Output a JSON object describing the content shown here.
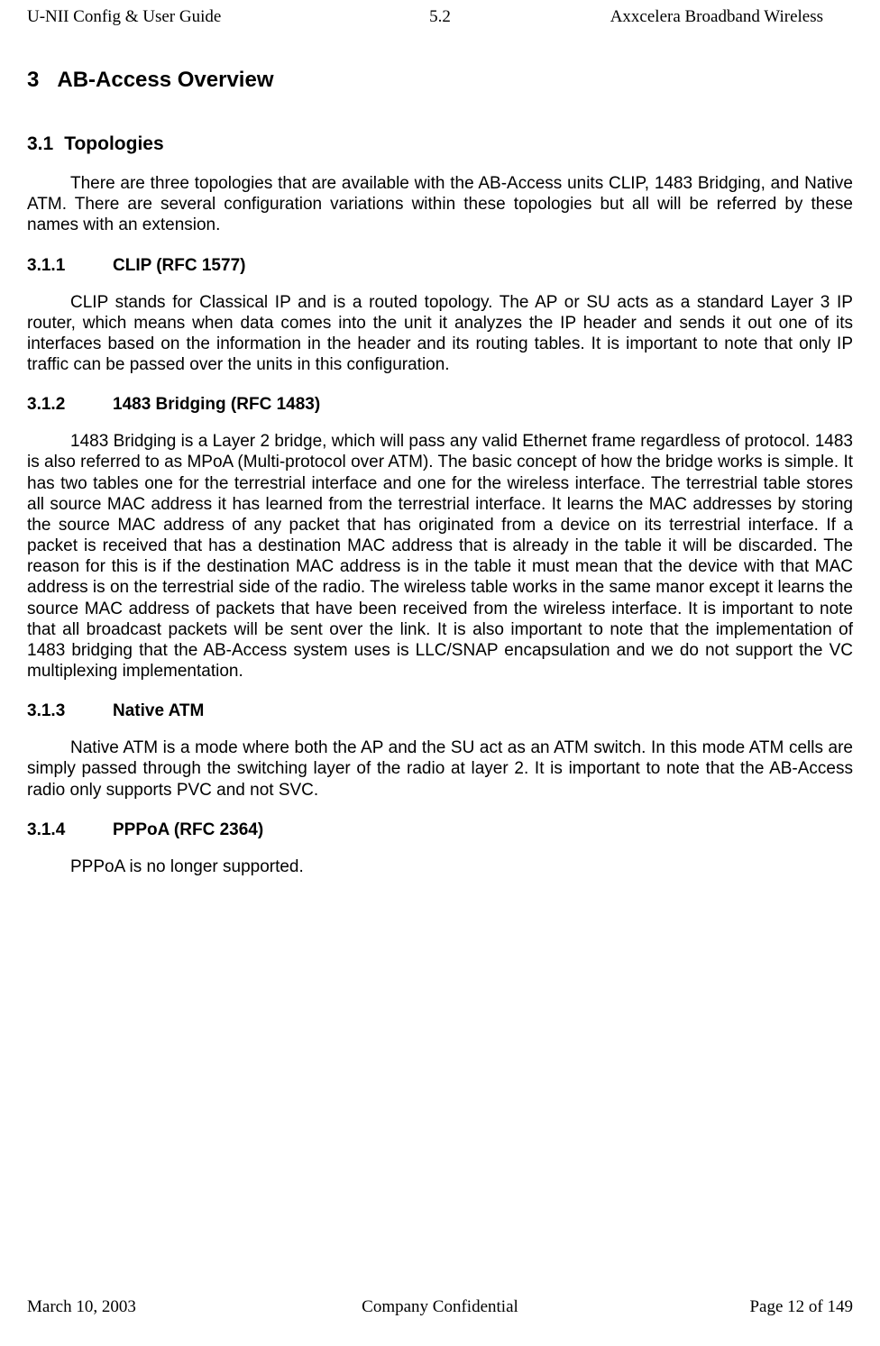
{
  "header": {
    "left": "U-NII Config & User Guide",
    "center": "5.2",
    "right": "Axxcelera Broadband Wireless"
  },
  "sections": {
    "s3": {
      "num": "3",
      "title": "AB-Access Overview"
    },
    "s3_1": {
      "num": "3.1",
      "title": "Topologies",
      "body": "There are three topologies that are available with the AB-Access units CLIP, 1483 Bridging, and Native ATM. There are several configuration variations within these topologies but all will be referred by these names with an extension."
    },
    "s3_1_1": {
      "num": "3.1.1",
      "title": "CLIP (RFC 1577)",
      "body": "CLIP stands for Classical IP and is a routed topology. The AP or SU acts as a standard Layer 3 IP router, which means when data comes into the unit it analyzes the IP header and sends it out one of its interfaces based on the information in the header and its routing tables. It is important to note that only IP traffic can be passed over the units in this configuration."
    },
    "s3_1_2": {
      "num": "3.1.2",
      "title": "1483 Bridging (RFC 1483)",
      "body": "1483 Bridging is a Layer 2 bridge, which will pass any valid Ethernet frame regardless of protocol. 1483 is also referred to as MPoA (Multi-protocol over ATM). The basic concept of how the bridge works is simple. It has two tables one for the terrestrial interface and one for the wireless interface. The terrestrial table stores all source MAC address it has learned from the terrestrial interface. It learns the MAC addresses by storing the source MAC address of any packet that has originated from a device on its terrestrial interface. If a packet is received that has a destination MAC address that is already in the table it will be discarded. The reason for this is if the destination MAC address is in the table it must mean that the device with that MAC address is on the terrestrial side of the radio. The wireless table works in the same manor except it learns the source MAC address of packets that have been received from the wireless interface. It is important to note that all broadcast packets will be sent over the link. It is also important to note that the implementation of 1483 bridging that the AB-Access system uses is LLC/SNAP encapsulation and we do not support the VC multiplexing implementation."
    },
    "s3_1_3": {
      "num": "3.1.3",
      "title": "Native ATM",
      "body": "Native ATM is a mode where both the AP and the SU act as an ATM switch. In this mode ATM cells are simply passed through the switching layer of the radio at layer 2. It is important to note that the AB-Access radio only supports PVC and not SVC."
    },
    "s3_1_4": {
      "num": "3.1.4",
      "title": "PPPoA (RFC 2364)",
      "body": "PPPoA is no longer supported."
    }
  },
  "footer": {
    "left": "March 10, 2003",
    "center": "Company Confidential",
    "right": "Page 12 of 149"
  }
}
